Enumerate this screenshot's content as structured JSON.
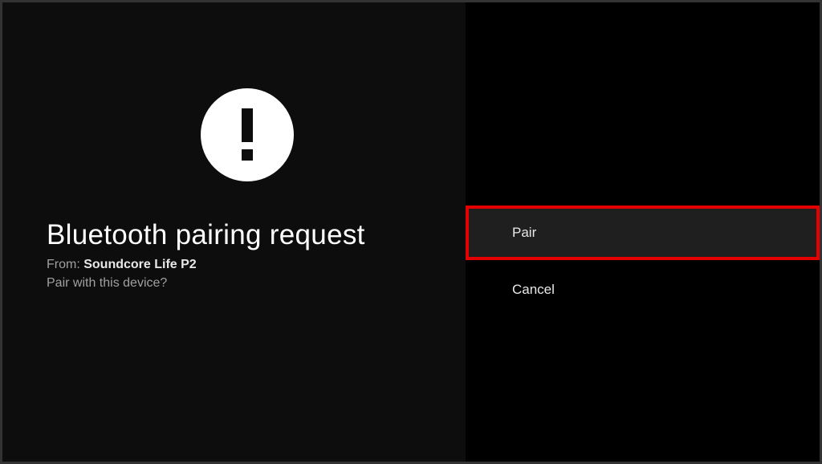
{
  "dialog": {
    "title": "Bluetooth pairing request",
    "from_label": "From: ",
    "device_name": "Soundcore Life P2",
    "prompt": "Pair with this device?"
  },
  "actions": {
    "pair_label": "Pair",
    "cancel_label": "Cancel"
  },
  "highlight": {
    "color": "#e40000"
  }
}
